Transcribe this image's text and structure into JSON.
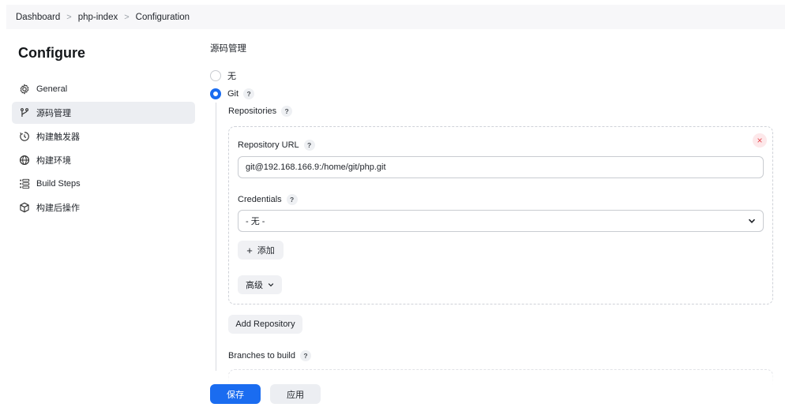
{
  "breadcrumb": [
    "Dashboard",
    "php-index",
    "Configuration"
  ],
  "page_title": "Configure",
  "sidebar": {
    "items": [
      {
        "label": "General",
        "icon": "gear-icon"
      },
      {
        "label": "源码管理",
        "icon": "branch-icon"
      },
      {
        "label": "构建触发器",
        "icon": "clock-icon"
      },
      {
        "label": "构建环境",
        "icon": "globe-icon"
      },
      {
        "label": "Build Steps",
        "icon": "list-icon"
      },
      {
        "label": "构建后操作",
        "icon": "cube-icon"
      }
    ]
  },
  "scm": {
    "title": "源码管理",
    "option_none": "无",
    "option_git": "Git",
    "repositories_label": "Repositories",
    "repository_url_label": "Repository URL",
    "repository_url_value": "git@192.168.166.9:/home/git/php.git",
    "credentials_label": "Credentials",
    "credentials_value": "- 无 -",
    "add_label": "添加",
    "advanced_label": "高级",
    "add_repository_label": "Add Repository",
    "branches_label": "Branches to build"
  },
  "help_symbol": "?",
  "remove_symbol": "×",
  "actions": {
    "save": "保存",
    "apply": "应用"
  },
  "colors": {
    "accent": "#1a6cf0",
    "danger": "#e5484d"
  }
}
